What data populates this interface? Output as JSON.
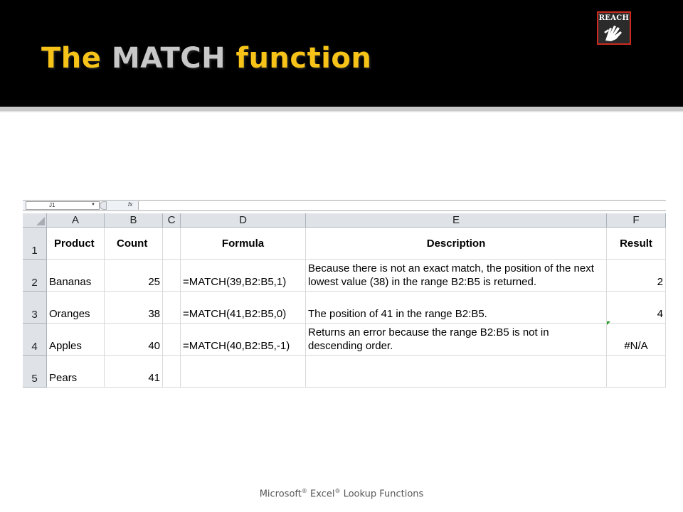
{
  "slide": {
    "title_part1": "The ",
    "title_part2": "MATCH",
    "title_part3": " function",
    "logo_text": "REACH",
    "footer_part1": "Microsoft",
    "footer_reg1": "®",
    "footer_part2": " Excel",
    "footer_reg2": "®",
    "footer_part3": " Lookup Functions"
  },
  "formula_bar": {
    "name_box": "J1",
    "fx": "fx"
  },
  "columns": [
    "A",
    "B",
    "C",
    "D",
    "E",
    "F"
  ],
  "rows": [
    "1",
    "2",
    "3",
    "4",
    "5"
  ],
  "table": {
    "headers": {
      "product": "Product",
      "count": "Count",
      "formula": "Formula",
      "description": "Description",
      "result": "Result"
    },
    "data": [
      {
        "product": "Bananas",
        "count": "25",
        "formula": "=MATCH(39,B2:B5,1)",
        "description": "Because there is not an exact match, the position of the next lowest value (38) in the range B2:B5 is returned.",
        "result": "2"
      },
      {
        "product": "Oranges",
        "count": "38",
        "formula": "=MATCH(41,B2:B5,0)",
        "description": "The position of 41 in the range B2:B5.",
        "result": "4"
      },
      {
        "product": "Apples",
        "count": "40",
        "formula": "=MATCH(40,B2:B5,-1)",
        "description": "Returns an error because the range B2:B5 is not in descending order.",
        "result": "#N/A"
      },
      {
        "product": "Pears",
        "count": "41",
        "formula": "",
        "description": "",
        "result": ""
      }
    ]
  },
  "colors": {
    "title_yellow": "#f7c318",
    "title_gray": "#c8c8c8",
    "band": "#000000",
    "logo_border": "#cc2a1e"
  }
}
